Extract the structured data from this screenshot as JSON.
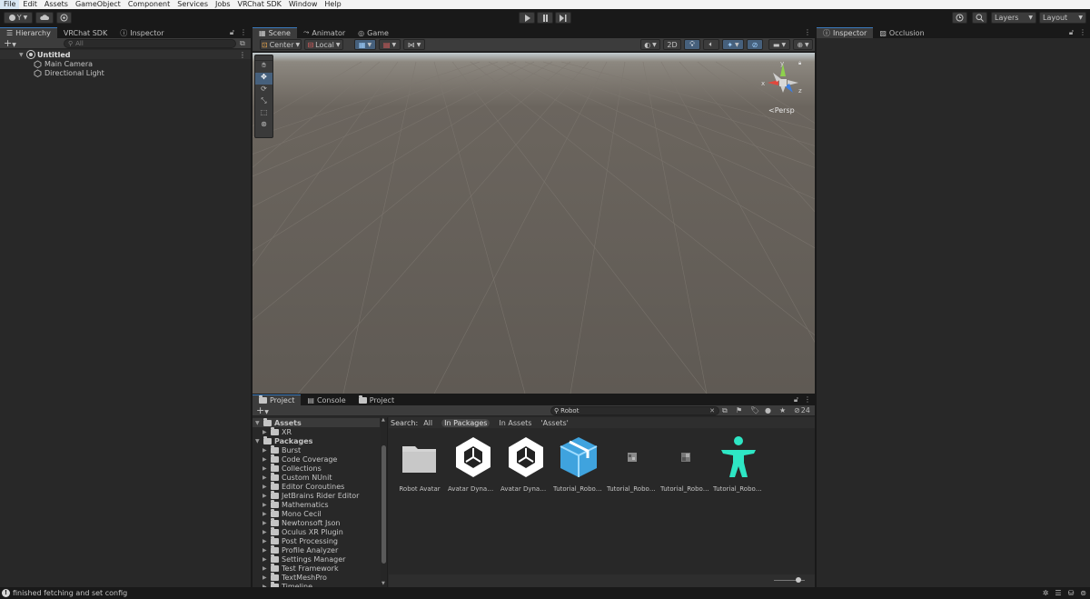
{
  "menubar": {
    "items": [
      "File",
      "Edit",
      "Assets",
      "GameObject",
      "Component",
      "Services",
      "Jobs",
      "VRChat SDK",
      "Window",
      "Help"
    ]
  },
  "toolbar": {
    "account_label": "Y",
    "layers_label": "Layers",
    "layout_label": "Layout"
  },
  "hierarchy": {
    "tabs": [
      "Hierarchy",
      "VRChat SDK",
      "Inspector"
    ],
    "search_placeholder": "All",
    "scene_name": "Untitled",
    "objects": [
      "Main Camera",
      "Directional Light"
    ]
  },
  "scene": {
    "tabs": [
      "Scene",
      "Animator",
      "Game"
    ],
    "pivot_label": "Center",
    "space_label": "Local",
    "mode_2d_label": "2D",
    "gizmo_labels": {
      "y": "y",
      "x": "x",
      "z": "z"
    },
    "projection_label": "Persp"
  },
  "inspector": {
    "tabs": [
      "Inspector",
      "Occlusion"
    ]
  },
  "project": {
    "tabs": [
      "Project",
      "Console",
      "Project"
    ],
    "search_value": "Robot",
    "hidden_count": "24",
    "search_filter_label": "Search:",
    "filters": [
      "All",
      "In Packages",
      "In Assets",
      "'Assets'"
    ],
    "tree": {
      "assets_label": "Assets",
      "assets_children": [
        "XR"
      ],
      "packages_label": "Packages",
      "packages_children": [
        "Burst",
        "Code Coverage",
        "Collections",
        "Custom NUnit",
        "Editor Coroutines",
        "JetBrains Rider Editor",
        "Mathematics",
        "Mono Cecil",
        "Newtonsoft Json",
        "Oculus XR Plugin",
        "Post Processing",
        "Profile Analyzer",
        "Settings Manager",
        "Test Framework",
        "TextMeshPro",
        "Timeline"
      ]
    },
    "assets": [
      {
        "label": "Robot Avatar",
        "icon": "folder-icon"
      },
      {
        "label": "Avatar Dynam...",
        "icon": "unity-logo-icon"
      },
      {
        "label": "Avatar Dynam...",
        "icon": "unity-logo-icon"
      },
      {
        "label": "Tutorial_Robot...",
        "icon": "package-icon"
      },
      {
        "label": "Tutorial_Robot...",
        "icon": "texture-icon"
      },
      {
        "label": "Tutorial_Robot...",
        "icon": "texture-icon"
      },
      {
        "label": "Tutorial_Robot...",
        "icon": "avatar-icon"
      }
    ]
  },
  "status": {
    "message": "finished fetching and set config"
  },
  "colors": {
    "accent": "#3a79bb",
    "avatar": "#2ee6c4",
    "package": "#55b6e8"
  }
}
